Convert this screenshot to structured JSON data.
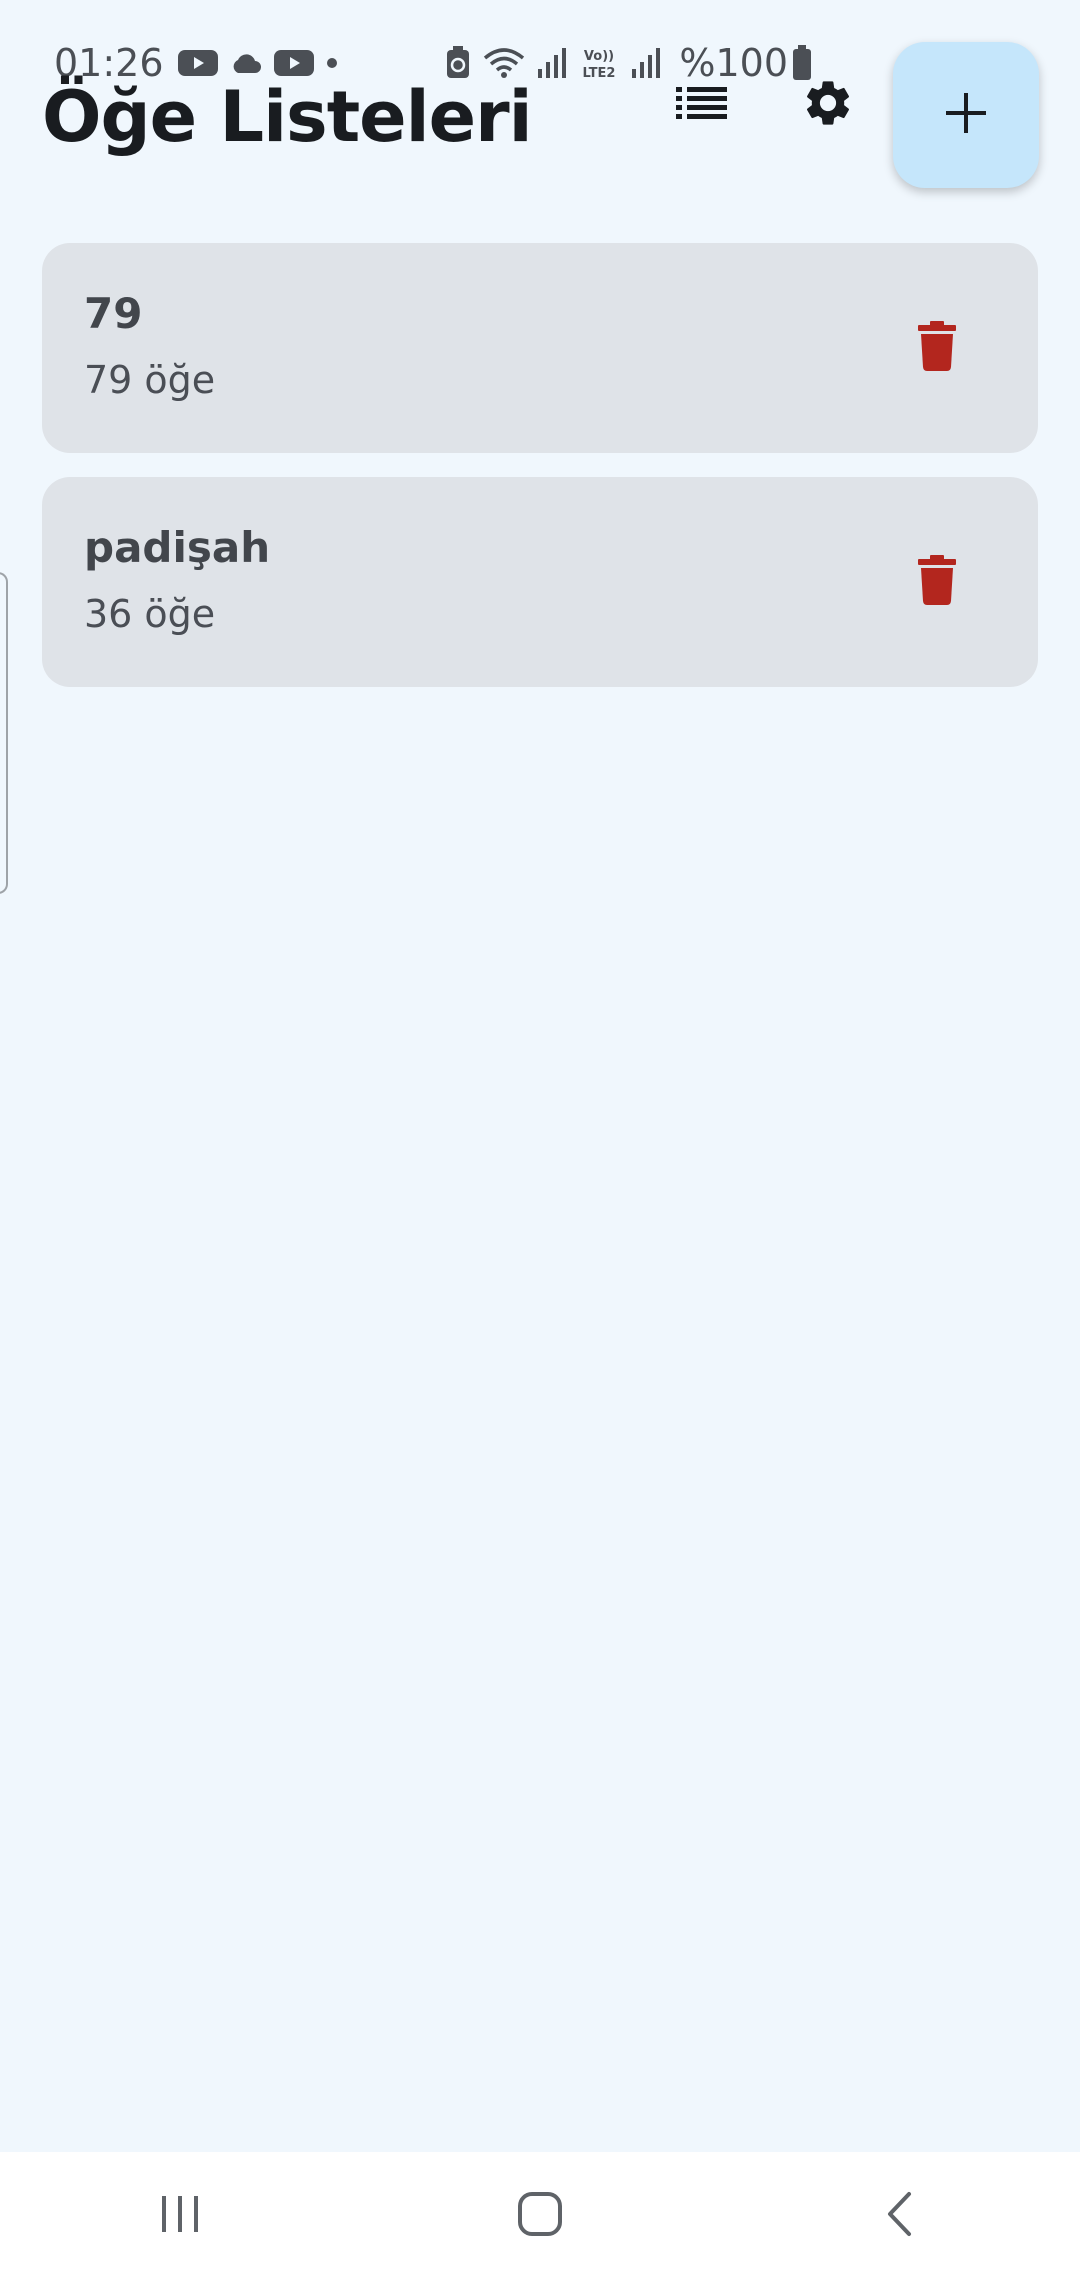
{
  "status_bar": {
    "time": "01:26",
    "battery": "%100",
    "icons": [
      "youtube-icon",
      "cloud-icon",
      "youtube-icon",
      "dot-icon",
      "battery-saver-icon",
      "wifi-icon",
      "signal-icon",
      "volte-lte2-icon",
      "signal-icon",
      "battery-icon"
    ]
  },
  "app_bar": {
    "title": "Öğe Listeleri",
    "actions": [
      "list-view-icon",
      "settings-icon",
      "add-icon"
    ]
  },
  "lists": [
    {
      "name": "79",
      "count_text": "79 öğe"
    },
    {
      "name": "padişah",
      "count_text": "36 öğe"
    }
  ],
  "nav_bar": {
    "buttons": [
      "recent-apps-icon",
      "home-icon",
      "back-icon"
    ]
  },
  "colors": {
    "background": "#f0f7fd",
    "card": "#dfe3e8",
    "fab": "#c5e6fb",
    "delete": "#b3261e",
    "title": "#191c20"
  }
}
